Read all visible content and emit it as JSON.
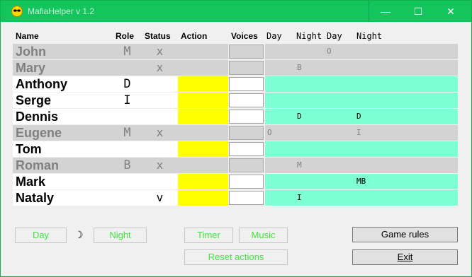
{
  "window": {
    "title": "MafiaHelper v 1.2",
    "minimize_glyph": "—",
    "maximize_glyph": "☐",
    "close_glyph": "✕",
    "accent": "#14c45c"
  },
  "headers": {
    "name": "Name",
    "role": "Role",
    "status": "Status",
    "action": "Action",
    "voices": "Voices",
    "day1": "Day",
    "night1": "Night",
    "day2": "Day",
    "night2": "Night"
  },
  "colors": {
    "action_active": "#ffff00",
    "game_active": "#7fffd4",
    "inactive": "#d3d3d3",
    "button_text": "#41e341"
  },
  "players": [
    {
      "name": "John",
      "role": "M",
      "status": "x",
      "alive": false,
      "d1": "",
      "n1": "",
      "d2": "O",
      "n2": ""
    },
    {
      "name": "Mary",
      "role": "",
      "status": "x",
      "alive": false,
      "d1": "",
      "n1": "B",
      "d2": "",
      "n2": ""
    },
    {
      "name": "Anthony",
      "role": "D",
      "status": "",
      "alive": true,
      "d1": "",
      "n1": "",
      "d2": "",
      "n2": ""
    },
    {
      "name": "Serge",
      "role": "I",
      "status": "",
      "alive": true,
      "d1": "",
      "n1": "",
      "d2": "",
      "n2": ""
    },
    {
      "name": "Dennis",
      "role": "",
      "status": "",
      "alive": true,
      "d1": "",
      "n1": "D",
      "d2": "",
      "n2": "D"
    },
    {
      "name": "Eugene",
      "role": "M",
      "status": "x",
      "alive": false,
      "d1": "O",
      "n1": "",
      "d2": "",
      "n2": "I"
    },
    {
      "name": "Tom",
      "role": "",
      "status": "",
      "alive": true,
      "d1": "",
      "n1": "",
      "d2": "",
      "n2": ""
    },
    {
      "name": "Roman",
      "role": "B",
      "status": "x",
      "alive": false,
      "d1": "",
      "n1": "M",
      "d2": "",
      "n2": ""
    },
    {
      "name": "Mark",
      "role": "",
      "status": "",
      "alive": true,
      "d1": "",
      "n1": "",
      "d2": "",
      "n2": "MB"
    },
    {
      "name": "Nataly",
      "role": "",
      "status": "v",
      "alive": true,
      "d1": "",
      "n1": "I",
      "d2": "",
      "n2": ""
    }
  ],
  "buttons": {
    "day": "Day",
    "moon": "☽",
    "night": "Night",
    "timer": "Timer",
    "music": "Music",
    "reset": "Reset actions",
    "game_rules": "Game rules",
    "exit": "Exit"
  }
}
